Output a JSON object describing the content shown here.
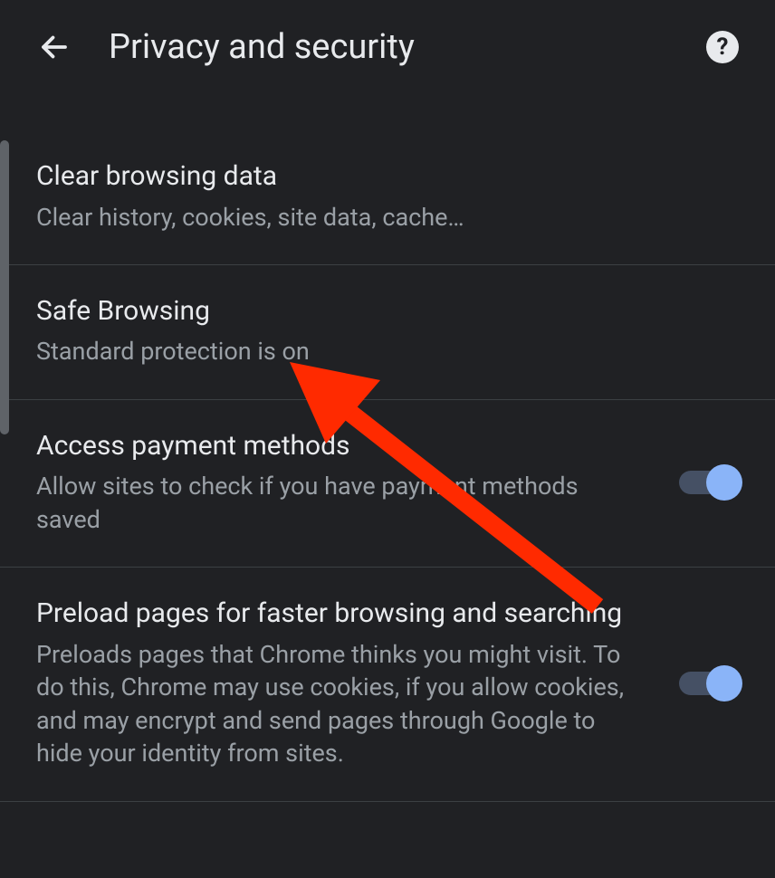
{
  "header": {
    "title": "Privacy and security"
  },
  "items": [
    {
      "title": "Clear browsing data",
      "subtitle": "Clear history, cookies, site data, cache…",
      "hasToggle": false
    },
    {
      "title": "Safe Browsing",
      "subtitle": "Standard protection is on",
      "hasToggle": false
    },
    {
      "title": "Access payment methods",
      "subtitle": "Allow sites to check if you have payment methods saved",
      "hasToggle": true,
      "toggleOn": true
    },
    {
      "title": "Preload pages for faster browsing and searching",
      "subtitle": "Preloads pages that Chrome thinks you might visit. To do this, Chrome may use cookies, if you allow cookies, and may encrypt and send pages through Google to hide your identity from sites.",
      "hasToggle": true,
      "toggleOn": true
    }
  ]
}
